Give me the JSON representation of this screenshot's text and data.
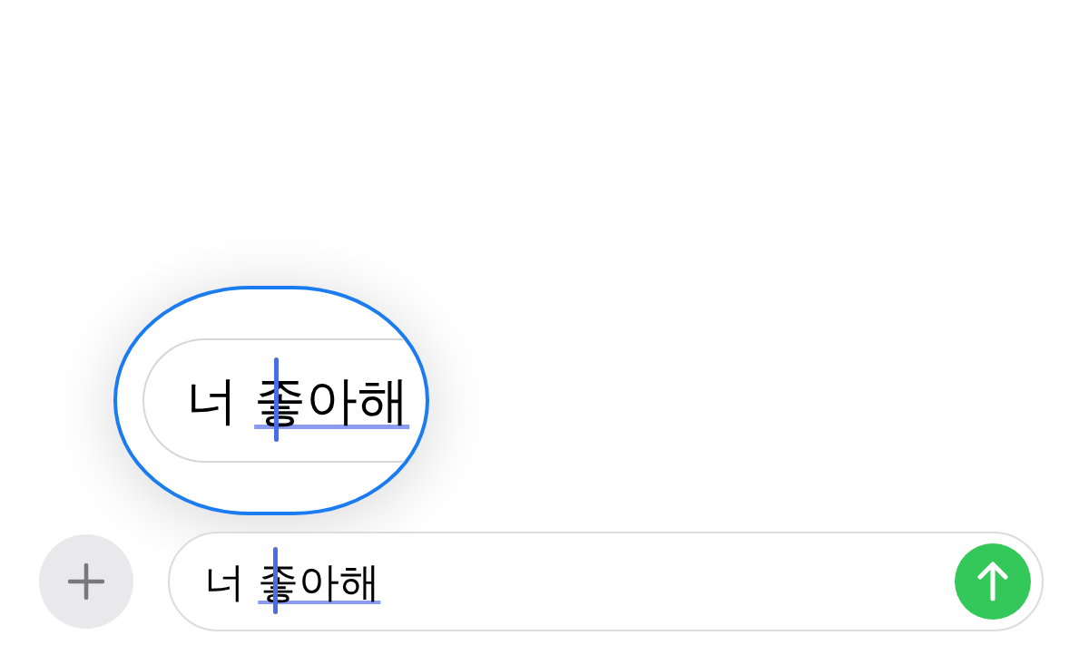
{
  "magnifier": {
    "text_parts": [
      {
        "text": "너 ",
        "marked": false
      },
      {
        "text": "좋아해",
        "marked": true
      }
    ],
    "caret": true
  },
  "composer": {
    "text_parts": [
      {
        "text": "너 ",
        "marked": false
      },
      {
        "text": "좋아해",
        "marked": true
      }
    ],
    "caret": true
  }
}
